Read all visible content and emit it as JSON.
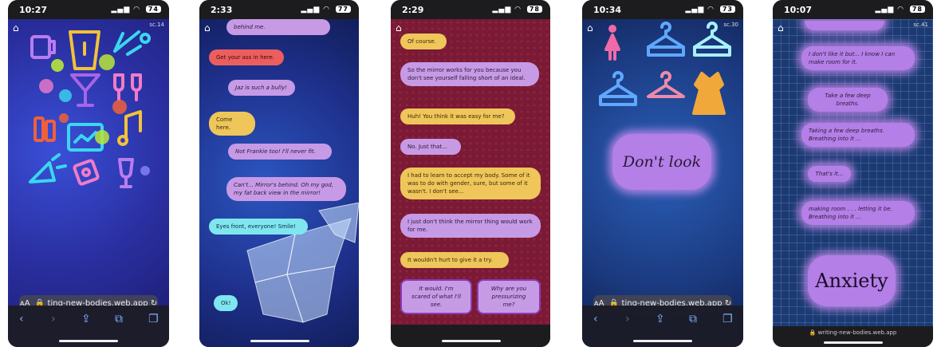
{
  "phones": [
    {
      "time": "10:27",
      "battery": "74",
      "scene": "sc.14",
      "url": "ting-new-bodies.web.app",
      "icons": [
        "beer-mug-icon",
        "cup-icon",
        "party-horn-icon",
        "cocktail-icon",
        "tv-icon",
        "bubbles-icon",
        "wine-icon",
        "bottles-icon",
        "cake-icon",
        "music-note-icon",
        "confetti-popper-icon",
        "gift-tag-icon",
        "wine-glass-icon"
      ]
    },
    {
      "time": "2:33",
      "battery": "77",
      "messages": [
        "behind me.",
        "Get your ass in here.",
        "Jaz is such a bully!",
        "Come here.",
        "Not Frankie too! I'll never fit.",
        "Can't... Mirror's behind. Oh my god, my fat back view in the mirror!",
        "Eyes front, everyone! Smile!",
        "Ok!"
      ]
    },
    {
      "time": "2:29",
      "battery": "78",
      "messages": [
        "Of course.",
        "So the mirror works for you because you don't see yourself falling short of an ideal.",
        "Huh! You think it was easy for me?",
        "No. Just that...",
        "I had to learn to accept my body. Some of it was to do with gender, sure, but some of it wasn't. I don't see...",
        "I just don't think the mirror thing would work for me.",
        "It wouldn't hurt to give it a try."
      ],
      "choices": [
        "It would. I'm scared of what I'll see.",
        "Why are you pressurizing me?"
      ]
    },
    {
      "time": "10:34",
      "battery": "73",
      "scene": "sc.30",
      "url": "ting-new-bodies.web.app",
      "icons": [
        "restroom-woman-icon",
        "hanger-icon",
        "hanger-icon",
        "hanger-icon",
        "hanger-icon",
        "dress-icon"
      ],
      "big_label": "Don't look"
    },
    {
      "time": "10:07",
      "battery": "78",
      "scene": "sc.41",
      "messages": [
        "I don't like it but... I know I can make room for it.",
        "Take a few deep breaths.",
        "Taking a few deep breaths. Breathing into it ...",
        "That's it...",
        "making room . . . letting it be. Breathing into it ..."
      ],
      "big_label": "Anxiety",
      "footer_url": "writing-new-bodies.web.app"
    }
  ],
  "colors": {
    "bubble_purple": "#c79ae6",
    "bubble_yellow": "#efc65a",
    "bubble_red": "#ec5e5e",
    "bubble_cyan": "#7fe6f0"
  }
}
